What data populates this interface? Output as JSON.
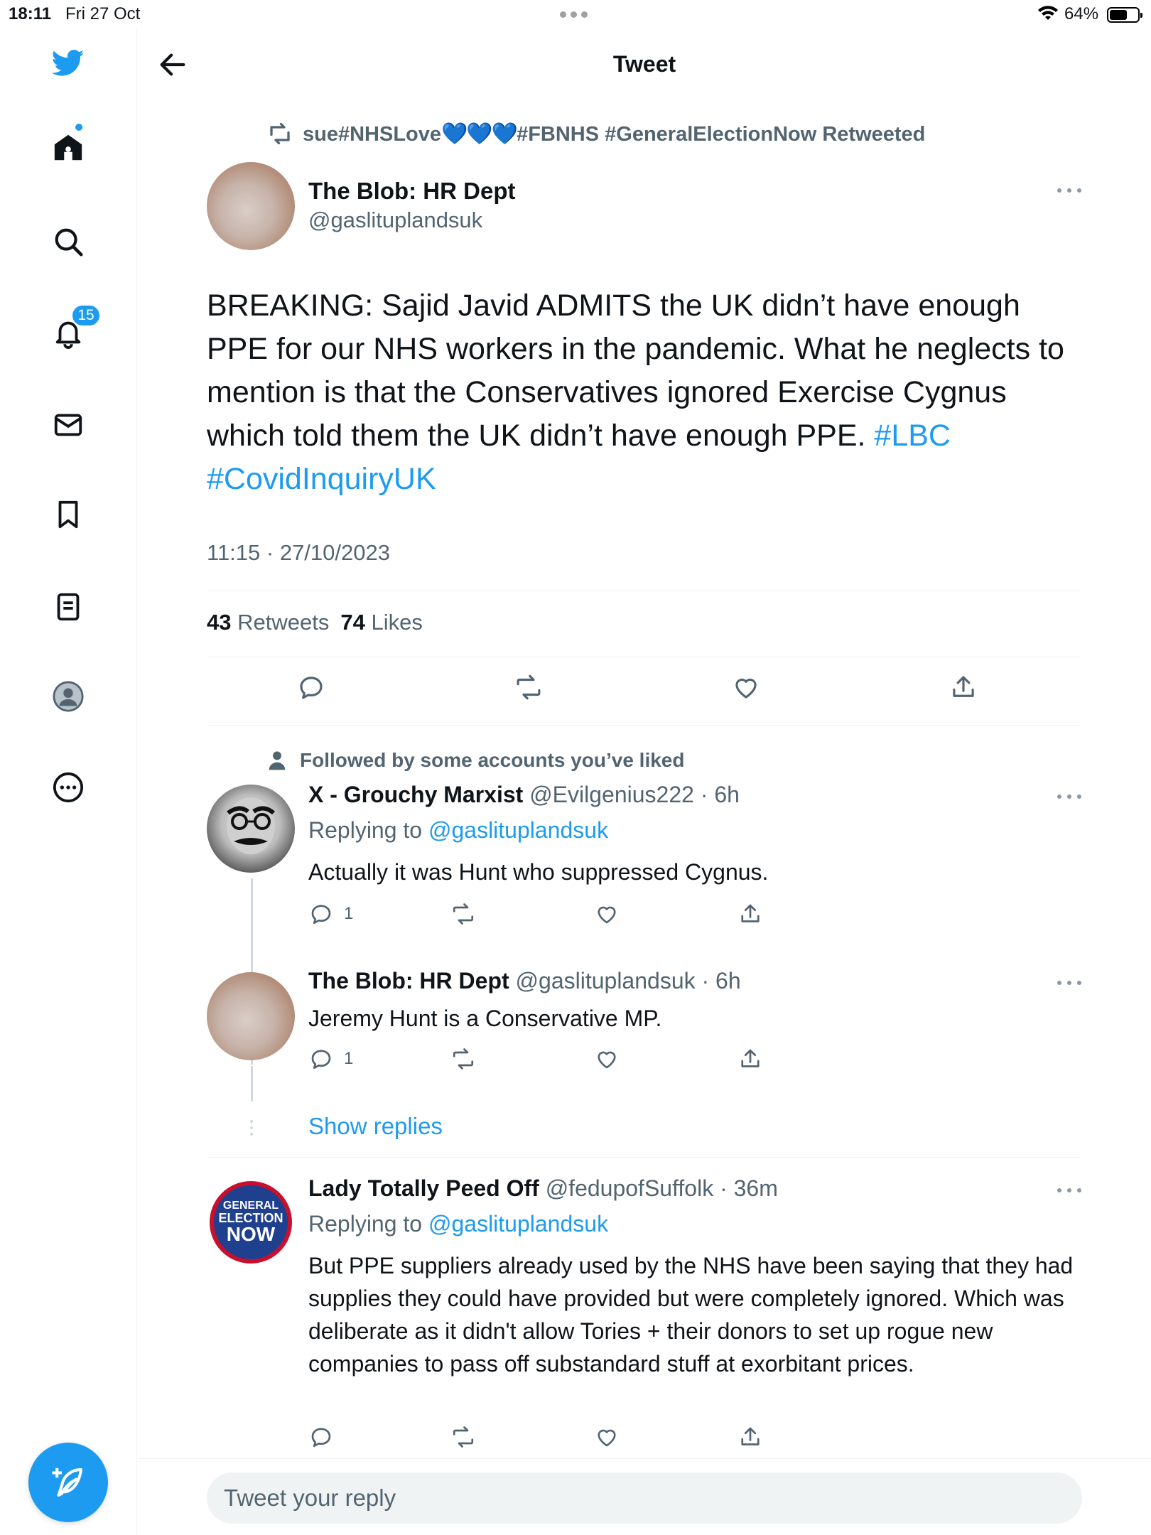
{
  "status_bar": {
    "time": "18:11",
    "date": "Fri 27 Oct",
    "battery": "64%",
    "battery_level": 0.64
  },
  "header": {
    "title": "Tweet"
  },
  "sidebar": {
    "notifications_count": "15"
  },
  "retweet_context": {
    "name": "sue#NHSLove",
    "hearts": "💙💙💙",
    "rest": "#FBNHS #GeneralElectionNow Retweeted"
  },
  "main_tweet": {
    "author_name": "The Blob: HR Dept",
    "author_handle": "@gaslituplandsuk",
    "text_plain": "BREAKING: Sajid Javid ADMITS the UK didn’t have enough PPE for our NHS workers in the pandemic. What he neglects to mention is that the Conservatives ignored Exercise Cygnus which told them the UK didn’t have enough PPE. ",
    "hashtag_1": "#LBC",
    "hashtag_2": "#CovidInquiryUK",
    "timestamp": "11:15 · 27/10/2023",
    "retweets_count": "43",
    "retweets_label": "Retweets",
    "likes_count": "74",
    "likes_label": "Likes"
  },
  "followed_context": "Followed by some accounts you’ve liked",
  "replies": [
    {
      "author_name": "X - Grouchy Marxist",
      "author_handle": "@Evilgenius222",
      "age": "6h",
      "replying_label": "Replying to",
      "replying_to": "@gaslituplandsuk",
      "text": "Actually it was Hunt who suppressed Cygnus.",
      "reply_count": "1"
    },
    {
      "author_name": "The Blob: HR Dept",
      "author_handle": "@gaslituplandsuk",
      "age": "6h",
      "text": "Jeremy Hunt is a Conservative MP.",
      "reply_count": "1"
    },
    {
      "author_name": "Lady Totally Peed Off",
      "author_handle": "@fedupofSuffolk",
      "age": "36m",
      "replying_label": "Replying to",
      "replying_to": "@gaslituplandsuk",
      "text": "But PPE suppliers already used by the NHS have been saying that they had supplies they could have provided but were completely ignored. Which was deliberate as it didn't allow Tories + their donors to set up rogue new companies to pass off substandard stuff at exorbitant prices.",
      "avatar_line1": "GENERAL",
      "avatar_line2": "ELECTION",
      "avatar_line3": "NOW"
    }
  ],
  "show_replies_label": "Show replies",
  "reply_box": {
    "placeholder": "Tweet your reply"
  },
  "colors": {
    "accent": "#1d9bf0",
    "muted": "#536471",
    "text": "#0f1419"
  }
}
